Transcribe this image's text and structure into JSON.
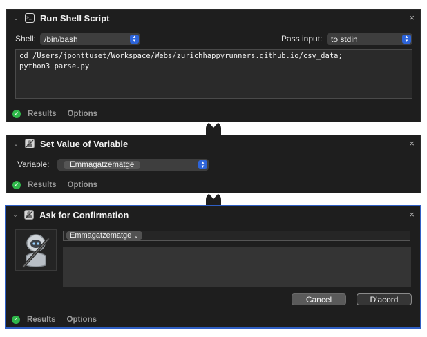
{
  "panels": [
    {
      "title": "Run Shell Script",
      "icon": "terminal-icon",
      "shell_label": "Shell:",
      "shell_value": "/bin/bash",
      "pass_input_label": "Pass input:",
      "pass_input_value": "to stdin",
      "code_lines": [
        "cd /Users/jponttuset/Workspace/Webs/zurichhappyrunners.github.io/csv_data;",
        "python3 parse.py"
      ],
      "tabs": {
        "results": "Results",
        "options": "Options"
      }
    },
    {
      "title": "Set Value of Variable",
      "icon": "automator-robot-icon",
      "variable_label": "Variable:",
      "variable_value": "Emmagatzematge",
      "tabs": {
        "results": "Results",
        "options": "Options"
      }
    },
    {
      "title": "Ask for Confirmation",
      "icon": "automator-robot-icon",
      "token": "Emmagatzematge",
      "token_arrow": "⌄",
      "cancel_label": "Cancel",
      "ok_label": "D'acord",
      "tabs": {
        "results": "Results",
        "options": "Options"
      }
    }
  ],
  "colors": {
    "panel_bg": "#1e1e1e",
    "selection": "#2f5fc4",
    "popup_accent": "#2d64d9",
    "success": "#2fb84a"
  },
  "glyphs": {
    "chevron": "⌄",
    "close": "×",
    "check": "✓",
    "stepper": "▴▾"
  }
}
